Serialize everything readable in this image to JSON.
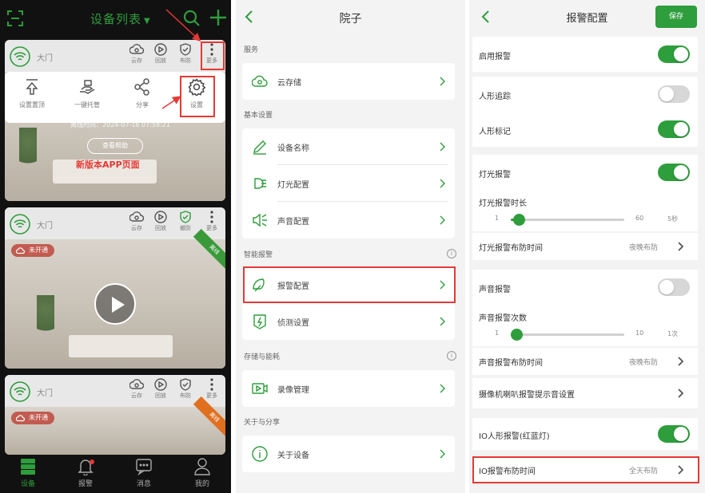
{
  "colors": {
    "accent": "#2e9d3c",
    "highlight": "#e53935"
  },
  "panel1": {
    "title": "设备列表",
    "menu_icon_label": "更多",
    "cards": [
      {
        "name": "大门",
        "buttons": [
          {
            "icon": "cloud-icon",
            "label": "云存"
          },
          {
            "icon": "playback-icon",
            "label": "回放"
          },
          {
            "icon": "shield-icon",
            "label": "布防"
          },
          {
            "icon": "more-icon",
            "label": "更多"
          }
        ]
      },
      {
        "name": "大门",
        "status": "未开通",
        "ribbon": "离线",
        "buttons": [
          {
            "icon": "cloud-icon",
            "label": "云存"
          },
          {
            "icon": "playback-icon",
            "label": "回放"
          },
          {
            "icon": "shield-icon",
            "label": "撤防"
          },
          {
            "icon": "more-icon",
            "label": "更多"
          }
        ]
      },
      {
        "name": "大门",
        "status": "未开通",
        "ribbon": "离线",
        "buttons": [
          {
            "icon": "cloud-icon",
            "label": "云存"
          },
          {
            "icon": "playback-icon",
            "label": "回放"
          },
          {
            "icon": "shield-icon",
            "label": "布防"
          },
          {
            "icon": "more-icon",
            "label": "更多"
          }
        ]
      }
    ],
    "popup_menu": [
      {
        "icon": "pin-top-icon",
        "label": "设置置顶"
      },
      {
        "icon": "one-key-invite-icon",
        "label": "一键托管"
      },
      {
        "icon": "share-icon",
        "label": "分享"
      },
      {
        "icon": "gear-icon",
        "label": "设置"
      }
    ],
    "last_time": "离线时间：2024-07-16 07:58:21",
    "help_button": "查看帮助",
    "watermark": "新版本APP页面",
    "bottom_nav": [
      {
        "icon": "devices-icon",
        "label": "设备",
        "active": true
      },
      {
        "icon": "bell-icon",
        "label": "报警",
        "active": false
      },
      {
        "icon": "message-icon",
        "label": "消息",
        "active": false
      },
      {
        "icon": "user-icon",
        "label": "我的",
        "active": false
      }
    ]
  },
  "panel2": {
    "title": "院子",
    "sections": [
      {
        "title": "服务",
        "info": false,
        "rows": [
          {
            "icon": "cloud-storage-icon",
            "label": "云存储"
          }
        ]
      },
      {
        "title": "基本设置",
        "info": false,
        "rows": [
          {
            "icon": "pen-icon",
            "label": "设备名称"
          },
          {
            "icon": "light-icon",
            "label": "灯光配置"
          },
          {
            "icon": "speaker-icon",
            "label": "声音配置"
          }
        ]
      },
      {
        "title": "智能报警",
        "info": true,
        "rows": [
          {
            "icon": "alarm-config-icon",
            "label": "报警配置"
          },
          {
            "icon": "detect-settings-icon",
            "label": "侦测设置"
          }
        ]
      },
      {
        "title": "存储与能耗",
        "info": true,
        "rows": [
          {
            "icon": "video-record-icon",
            "label": "录像管理"
          }
        ]
      },
      {
        "title": "关于与分享",
        "info": false,
        "rows": [
          {
            "icon": "info-icon",
            "label": "关于设备"
          }
        ]
      }
    ]
  },
  "panel3": {
    "title": "报警配置",
    "save_label": "保存",
    "rows": {
      "alarm_enable": {
        "label": "启用报警",
        "on": true
      },
      "human_track": {
        "label": "人形追踪",
        "on": false
      },
      "human_mark": {
        "label": "人形标记",
        "on": true
      },
      "light_alarm": {
        "label": "灯光报警",
        "on": true
      },
      "light_duration": {
        "label": "灯光报警时长",
        "min": "1",
        "max": "60",
        "value_label": "5秒",
        "value": 5,
        "range": [
          1,
          60
        ]
      },
      "light_schedule": {
        "label": "灯光报警布防时间",
        "value": "夜晚布防"
      },
      "sound_alarm": {
        "label": "声音报警",
        "on": false
      },
      "sound_count": {
        "label": "声音报警次数",
        "min": "1",
        "max": "10",
        "value_label": "1次",
        "value": 1,
        "range": [
          1,
          10
        ]
      },
      "sound_schedule": {
        "label": "声音报警布防时间",
        "value": "夜晚布防"
      },
      "camera_speaker": {
        "label": "摄像机喇叭报警提示音设置"
      },
      "io_human_alarm": {
        "label": "IO人形报警(红蓝灯)",
        "on": true
      },
      "io_schedule": {
        "label": "IO报警布防时间",
        "value": "全天布防"
      }
    }
  }
}
